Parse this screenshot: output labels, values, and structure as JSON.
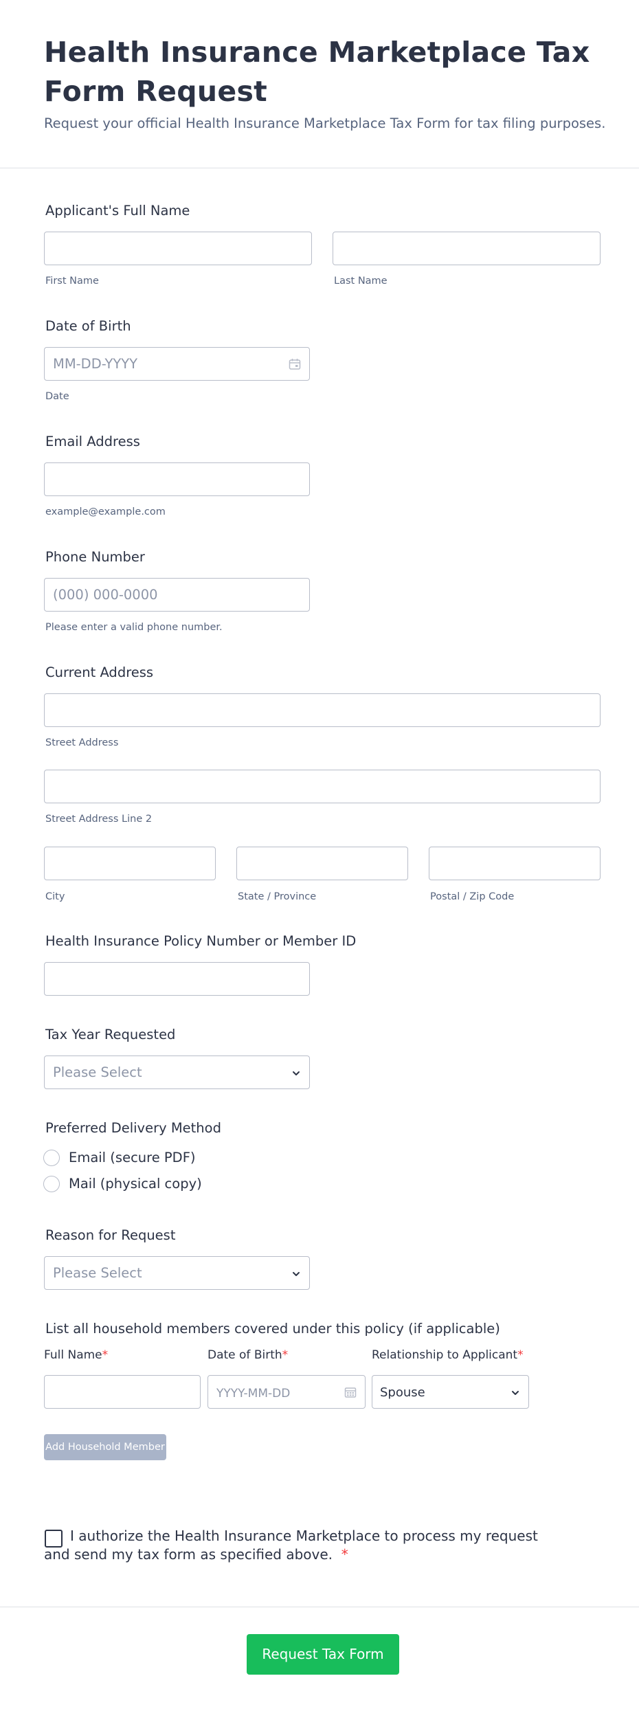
{
  "form": {
    "title": "Health Insurance Marketplace Tax Form Request",
    "subtitle": "Request your official Health Insurance Marketplace Tax Form for tax filing purposes."
  },
  "name": {
    "label": "Applicant's Full Name",
    "first_sublabel": "First Name",
    "last_sublabel": "Last Name",
    "first_value": "",
    "last_value": ""
  },
  "dob": {
    "label": "Date of Birth",
    "placeholder": "MM-DD-YYYY",
    "sublabel": "Date",
    "icon": "calendar-icon"
  },
  "email": {
    "label": "Email Address",
    "value": "",
    "sublabel": "example@example.com"
  },
  "phone": {
    "label": "Phone Number",
    "placeholder": "(000) 000-0000",
    "sublabel": "Please enter a valid phone number."
  },
  "address": {
    "label": "Current Address",
    "street_sublabel": "Street Address",
    "street2_sublabel": "Street Address Line 2",
    "city_sublabel": "City",
    "state_sublabel": "State / Province",
    "postal_sublabel": "Postal / Zip Code"
  },
  "policy": {
    "label": "Health Insurance Policy Number or Member ID",
    "value": ""
  },
  "tax_year": {
    "label": "Tax Year Requested",
    "placeholder": "Please Select"
  },
  "delivery": {
    "label": "Preferred Delivery Method",
    "options": [
      "Email (secure PDF)",
      "Mail (physical copy)"
    ],
    "selected": null
  },
  "reason": {
    "label": "Reason for Request",
    "placeholder": "Please Select"
  },
  "household": {
    "label": "List all household members covered under this policy (if applicable)",
    "columns": [
      "Full Name",
      "Date of Birth",
      "Relationship to Applicant"
    ],
    "required_mark": "*",
    "row": {
      "full_name": "",
      "dob_placeholder": "YYYY-MM-DD",
      "relationship": "Spouse"
    },
    "add_button": "Add Household Member"
  },
  "consent": {
    "text": "I authorize the Health Insurance Marketplace to process my request and send my tax form as specified above.",
    "required_mark": "*",
    "checked": false
  },
  "submit": {
    "label": "Request Tax Form"
  },
  "colors": {
    "text": "#2c3345",
    "muted": "#57647e",
    "placeholder": "#8d95a7",
    "border": "#b8bdc9",
    "required": "#f23a3c",
    "submit": "#18bd5b",
    "add_button": "#a9b4c9"
  }
}
